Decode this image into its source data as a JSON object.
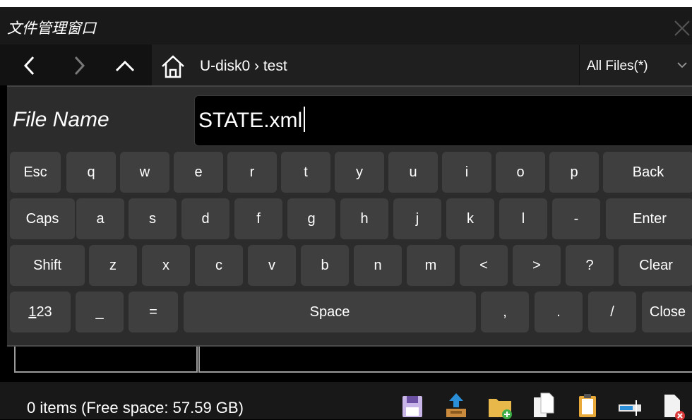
{
  "window": {
    "title": "文件管理窗口",
    "close_glyph": "×"
  },
  "nav": {
    "back_icon": "chevron-left-icon",
    "forward_icon": "chevron-right-icon",
    "up_icon": "chevron-up-icon",
    "breadcrumb": "U-disk0 › test",
    "filter_value": "All Files(*)"
  },
  "dialog": {
    "file_name_label": "File Name",
    "file_name_value": "STATE.xml"
  },
  "keyboard": {
    "row1": [
      "Esc",
      "q",
      "w",
      "e",
      "r",
      "t",
      "y",
      "u",
      "i",
      "o",
      "p",
      "Back"
    ],
    "row2": [
      "Caps",
      "a",
      "s",
      "d",
      "f",
      "g",
      "h",
      "j",
      "k",
      "l",
      "-",
      "Enter"
    ],
    "row3": [
      "Shift",
      "z",
      "x",
      "c",
      "v",
      "b",
      "n",
      "m",
      "<",
      ">",
      "?",
      "Clear"
    ],
    "row4_num_u": "1",
    "row4_num_rest": "23",
    "row4": [
      "_",
      "=",
      "Space",
      ",",
      ".",
      "/",
      "Close"
    ]
  },
  "status": {
    "text": "0 items (Free space: 57.59 GB)"
  },
  "toolbar": {
    "icons": [
      "save-icon",
      "upload-icon",
      "new-folder-icon",
      "copy-icon",
      "paste-icon",
      "rename-icon",
      "delete-file-icon"
    ]
  },
  "colors": {
    "background": "#000000",
    "panel": "#2c2c2c",
    "key": "#3f3f3f",
    "title_bar": "#191919"
  }
}
